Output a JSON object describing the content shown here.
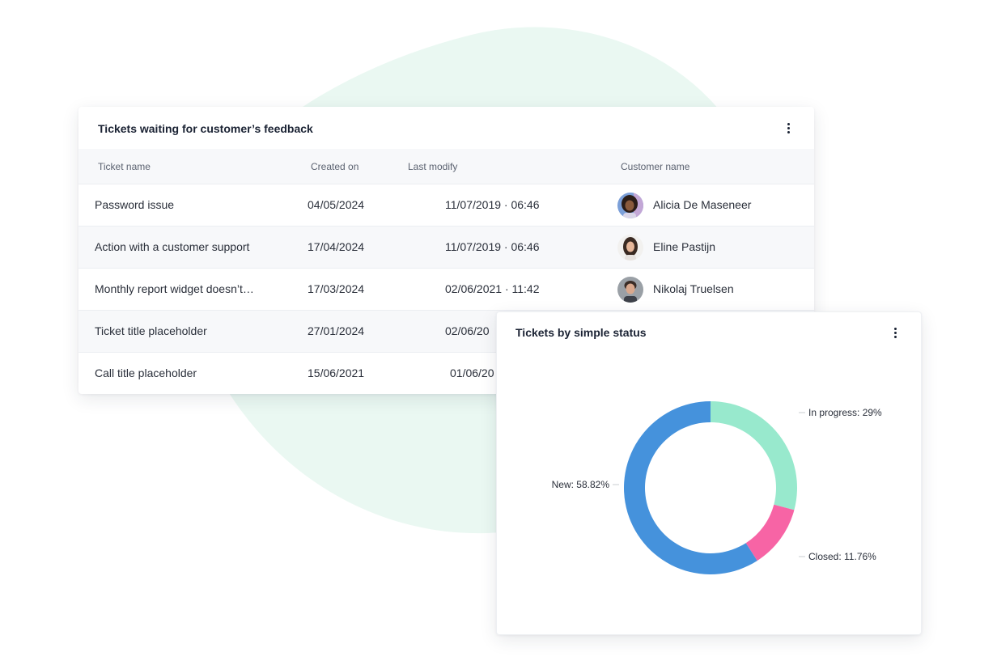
{
  "table": {
    "title": "Tickets waiting for customer’s feedback",
    "columns": [
      "Ticket name",
      "Created on",
      "Last modify",
      "Customer name"
    ],
    "rows": [
      {
        "ticket": "Password issue",
        "created": "04/05/2024",
        "modified": "11/07/2019 · 06:46",
        "customer": "Alicia De Maseneer"
      },
      {
        "ticket": "Action with a customer support",
        "created": "17/04/2024",
        "modified": "11/07/2019 · 06:46",
        "customer": "Eline Pastijn"
      },
      {
        "ticket": "Monthly report widget doesn’t…",
        "created": "17/03/2024",
        "modified": "02/06/2021 · 11:42",
        "customer": "Nikolaj Truelsen"
      },
      {
        "ticket": "Ticket title placeholder",
        "created": "27/01/2024",
        "modified": "02/06/20",
        "customer": ""
      },
      {
        "ticket": "Call title placeholder",
        "created": "15/06/2021",
        "modified": "01/06/20",
        "customer": ""
      }
    ]
  },
  "chart_card": {
    "title": "Tickets by simple status"
  },
  "chart_data": {
    "type": "pie",
    "donut": true,
    "title": "Tickets by simple status",
    "slices": [
      {
        "name": "In progress",
        "value": 29,
        "label": "In progress: 29%",
        "color": "#98e9cd"
      },
      {
        "name": "Closed",
        "value": 11.76,
        "label": "Closed: 11.76%",
        "color": "#f764a5"
      },
      {
        "name": "New",
        "value": 58.82,
        "label": "New: 58.82%",
        "color": "#4592dc"
      }
    ]
  },
  "colors": {
    "background_blob": "#eaf8f2",
    "header_bg": "#f7f8fa"
  },
  "icons": {
    "menu": "more-vertical-icon"
  }
}
